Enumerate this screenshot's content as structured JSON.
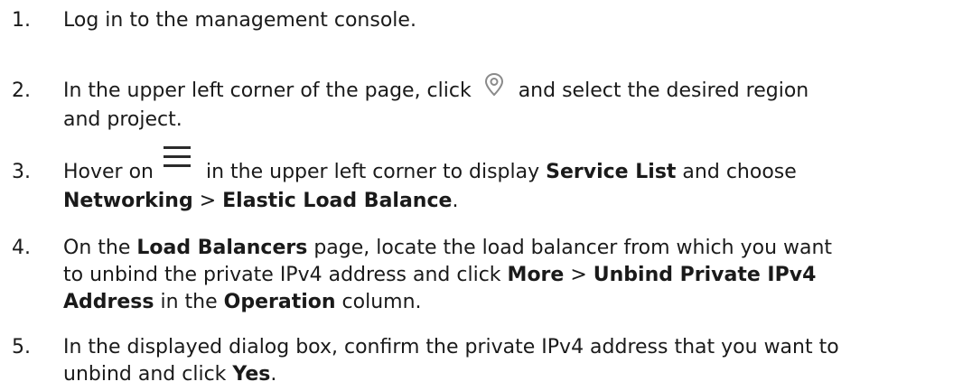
{
  "steps": [
    {
      "number": "1.",
      "text": "Log in to the management console."
    },
    {
      "number": "2.",
      "line1_before_icon": "In the upper left corner of the page, click ",
      "line1_after_icon": " and select the desired region",
      "line2": "and project.",
      "icon": "location-pin-icon"
    },
    {
      "number": "3.",
      "line1_before_icon": "Hover on ",
      "line1_after_icon": " in the upper left corner to display ",
      "bold1": "Service List",
      "line1_tail": " and choose",
      "bold2": "Networking",
      "sep": " > ",
      "bold3": "Elastic Load Balance",
      "period": ".",
      "icon": "hamburger-menu-icon"
    },
    {
      "number": "4.",
      "t1": "On the ",
      "b1": "Load Balancers",
      "t2": " page, locate the load balancer from which you want",
      "t3": "to unbind the private IPv4 address and click ",
      "b2": "More",
      "t4": " > ",
      "b3": "Unbind Private IPv4",
      "b4": "Address",
      "t5": " in the ",
      "b5": "Operation",
      "t6": " column."
    },
    {
      "number": "5.",
      "t1": "In the displayed dialog box, confirm the private IPv4 address that you want to",
      "t2": "unbind and click ",
      "b1": "Yes",
      "t3": "."
    }
  ]
}
